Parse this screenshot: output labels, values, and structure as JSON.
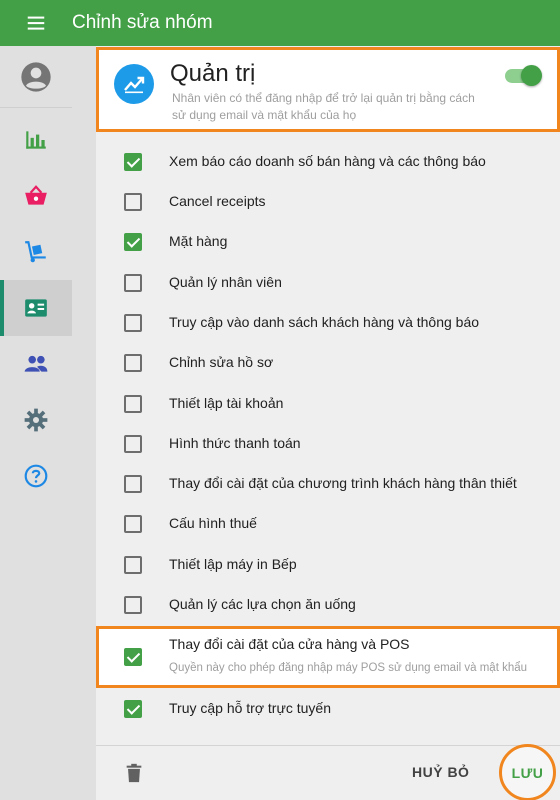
{
  "app": {
    "title": "Chỉnh sửa nhóm"
  },
  "rail": {
    "items": [
      {
        "name": "account",
        "icon": "account-circle-icon",
        "color": "#757575"
      },
      {
        "name": "reports",
        "icon": "bar-chart-icon",
        "color": "#43a047"
      },
      {
        "name": "sales",
        "icon": "basket-icon",
        "color": "#e91e63"
      },
      {
        "name": "inventory",
        "icon": "dolly-icon",
        "color": "#1e88e5"
      },
      {
        "name": "employees",
        "icon": "badge-icon",
        "color": "#1d8c6d",
        "active": true
      },
      {
        "name": "customers",
        "icon": "people-icon",
        "color": "#3f51b5"
      },
      {
        "name": "settings",
        "icon": "gear-icon",
        "color": "#546e7a"
      },
      {
        "name": "help",
        "icon": "help-circle-icon",
        "color": "#1e88e5"
      }
    ]
  },
  "role": {
    "title": "Quản trị",
    "description": "Nhân viên có thể đăng nhập để trở lại quản trị bằng cách sử dụng email và mật khẩu của họ",
    "enabled": true
  },
  "permissions": [
    {
      "label": "Xem báo cáo doanh số bán hàng và các thông báo",
      "checked": true
    },
    {
      "label": "Cancel receipts",
      "checked": false
    },
    {
      "label": "Mặt hàng",
      "checked": true
    },
    {
      "label": "Quản lý nhân viên",
      "checked": false
    },
    {
      "label": "Truy cập vào danh sách khách hàng và thông báo",
      "checked": false
    },
    {
      "label": "Chỉnh sửa hồ sơ",
      "checked": false
    },
    {
      "label": "Thiết lập tài khoản",
      "checked": false
    },
    {
      "label": "Hình thức thanh toán",
      "checked": false
    },
    {
      "label": "Thay đổi cài đặt của chương trình khách hàng thân thiết",
      "checked": false
    },
    {
      "label": "Cấu hình thuế",
      "checked": false
    },
    {
      "label": "Thiết lập máy in Bếp",
      "checked": false
    },
    {
      "label": "Quản lý các lựa chọn ăn uống",
      "checked": false
    },
    {
      "label": "Thay đổi cài đặt của cửa hàng và POS",
      "sublabel": "Quyền này cho phép đăng nhập máy POS sử dụng email và mật khẩu",
      "checked": true,
      "highlighted": true
    },
    {
      "label": "Truy cập hỗ trợ trực tuyến",
      "checked": true
    }
  ],
  "footer": {
    "cancel_label": "HUỶ BỎ",
    "save_label": "LƯU"
  },
  "colors": {
    "appbar": "#43a047",
    "accent": "#43a047",
    "highlight": "#f0861d",
    "role_icon": "#1e9be8"
  }
}
